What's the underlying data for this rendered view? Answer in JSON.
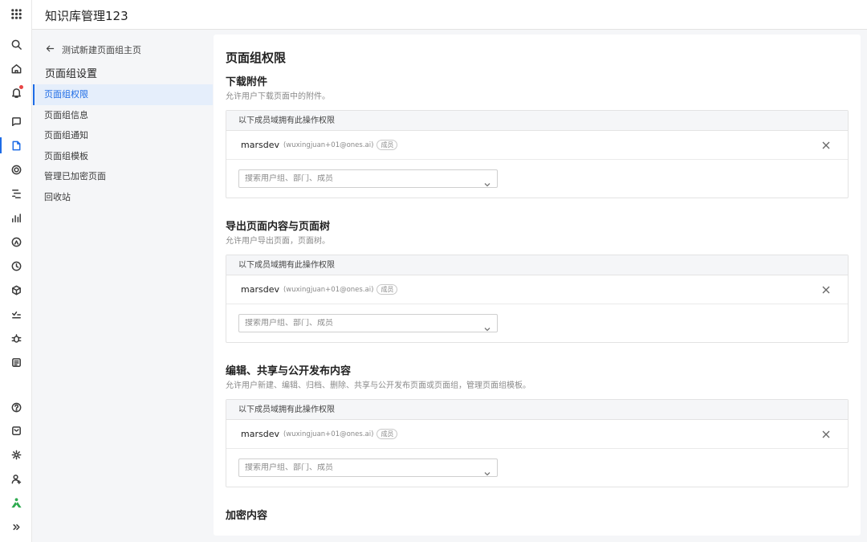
{
  "app": {
    "title": "知识库管理123"
  },
  "rail": {
    "icons": [
      "apps-grid-icon",
      "search-icon",
      "home-icon",
      "notification-bell-icon",
      "project-icon",
      "wiki-icon",
      "target-icon",
      "workflow-icon",
      "report-icon",
      "pipeline-icon",
      "clock-icon",
      "package-icon",
      "testcase-icon",
      "bug-icon",
      "document-icon",
      "help-icon",
      "message-box-icon",
      "settings-icon",
      "add-user-icon",
      "brand-logo-icon",
      "expand-icon"
    ],
    "accent": "#1e6ce6"
  },
  "sidebar": {
    "back_label": "测试新建页面组主页",
    "title": "页面组设置",
    "items": [
      {
        "label": "页面组权限",
        "active": true
      },
      {
        "label": "页面组信息"
      },
      {
        "label": "页面组通知"
      },
      {
        "label": "页面组模板"
      },
      {
        "label": "管理已加密页面"
      },
      {
        "label": "回收站"
      }
    ]
  },
  "main": {
    "title": "页面组权限",
    "sections": [
      {
        "title": "下载附件",
        "description": "允许用户下载页面中的附件。",
        "box_header": "以下成员域拥有此操作权限",
        "member": {
          "name": "marsdev",
          "email": "(wuxingjuan+01@ones.ai)",
          "badge": "成员"
        },
        "search_placeholder": "搜索用户组、部门、成员"
      },
      {
        "title": "导出页面内容与页面树",
        "description": "允许用户导出页面，页面树。",
        "box_header": "以下成员域拥有此操作权限",
        "member": {
          "name": "marsdev",
          "email": "(wuxingjuan+01@ones.ai)",
          "badge": "成员"
        },
        "search_placeholder": "搜索用户组、部门、成员"
      },
      {
        "title": "编辑、共享与公开发布内容",
        "description": "允许用户新建、编辑、归档、删除、共享与公开发布页面或页面组，管理页面组模板。",
        "box_header": "以下成员域拥有此操作权限",
        "member": {
          "name": "marsdev",
          "email": "(wuxingjuan+01@ones.ai)",
          "badge": "成员"
        },
        "search_placeholder": "搜索用户组、部门、成员"
      },
      {
        "title": "加密内容"
      }
    ]
  }
}
